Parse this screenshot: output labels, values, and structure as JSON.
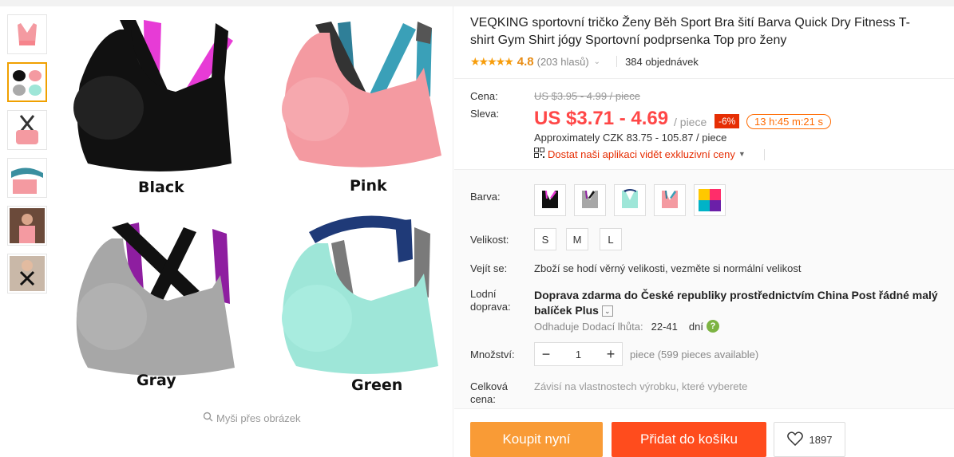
{
  "product": {
    "title": "VEQKING sportovní tričko Ženy Běh Sport Bra šití Barva Quick Dry Fitness T-shirt Gym Shirt jógy Sportovní podprsenka Top pro ženy",
    "rating": "4.8",
    "reviews": "(203 hlasů)",
    "orders": "384 objednávek"
  },
  "gallery": {
    "labels": [
      "Black",
      "Pink",
      "Gray",
      "Green"
    ],
    "hover_hint": "Myši přes obrázek"
  },
  "price": {
    "orig_label": "Cena:",
    "orig_value": "US $3.95 - 4.99 / piece",
    "sale_label": "Sleva:",
    "sale_value": "US $3.71 - 4.69",
    "per": "/ piece",
    "discount": "-6%",
    "timer": "13 h:45 m:21 s",
    "approx": "Approximately CZK 83.75 - 105.87 / piece",
    "app_link": "Dostat naši aplikaci vidět exkluzivní ceny"
  },
  "options": {
    "color_label": "Barva:",
    "size_label": "Velikost:",
    "sizes": [
      "S",
      "M",
      "L"
    ],
    "fit_label": "Vejít se:",
    "fit_value": "Zboží se hodí věrný velikosti, vezměte si normální velikost",
    "shipping_label": "Lodní doprava:",
    "shipping_value": "Doprava zdarma do České republiky prostřednictvím China Post řádné malý balíček Plus",
    "estimate_label": "Odhaduje Dodací lhůta:",
    "estimate_days": "22-41",
    "estimate_unit": "dní",
    "qty_label": "Množství:",
    "qty_value": "1",
    "qty_info": "piece (599 pieces available)",
    "total_label": "Celková cena:",
    "total_value": "Závisí na vlastnostech výrobku, které vyberete"
  },
  "actions": {
    "buy": "Koupit nyní",
    "cart": "Přidat do košíku",
    "wishlist_count": "1897"
  },
  "colors": {
    "accent": "#ff4747",
    "buy": "#f99b36",
    "cart": "#ff4c1d",
    "star": "#f79d0b"
  }
}
